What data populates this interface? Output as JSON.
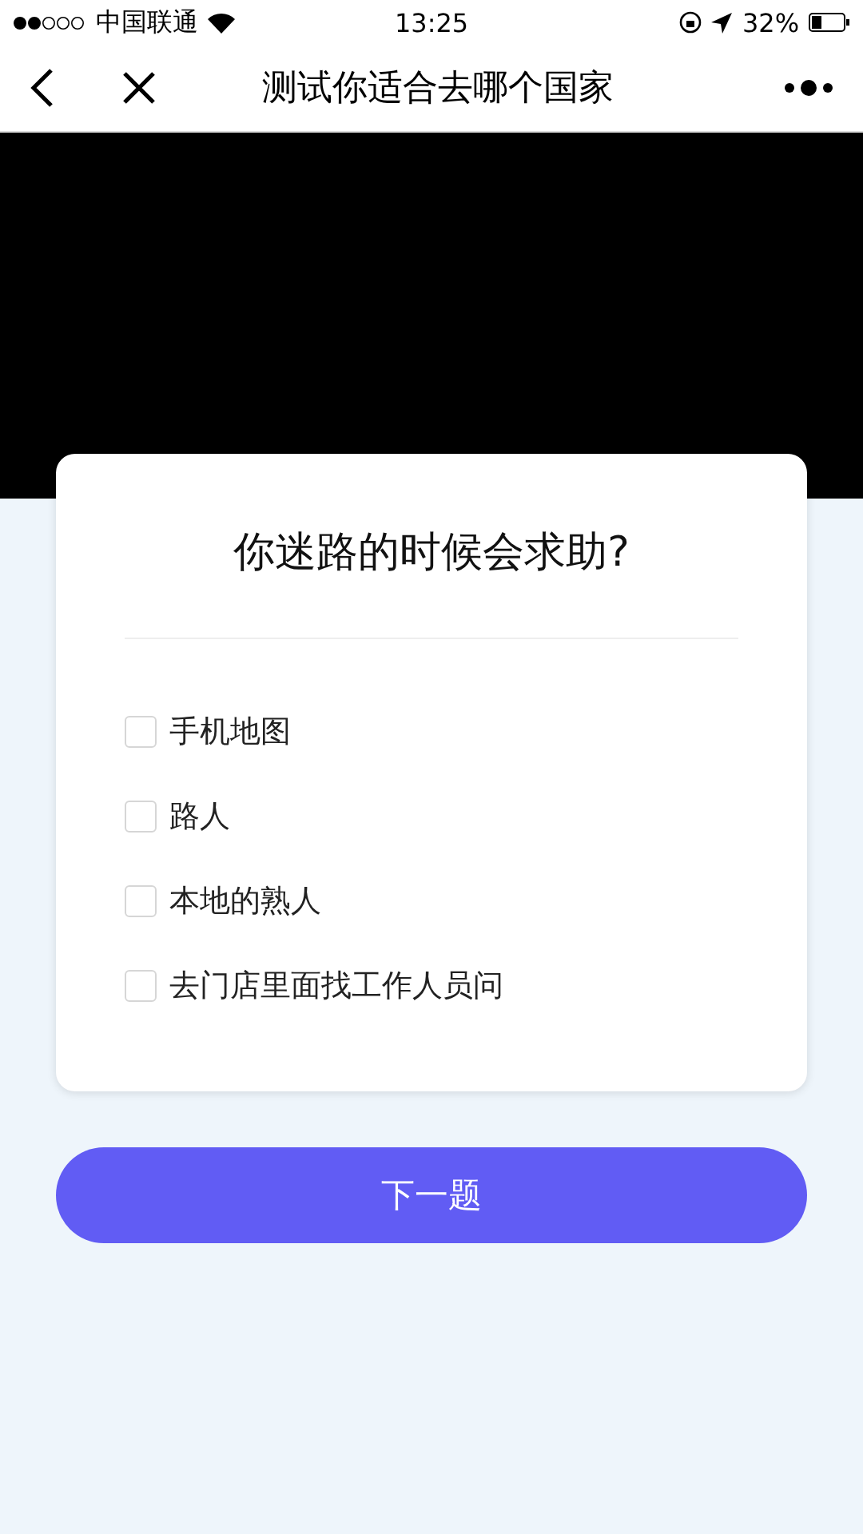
{
  "status_bar": {
    "carrier": "中国联通",
    "time": "13:25",
    "battery_text": "32%"
  },
  "nav_bar": {
    "title": "测试你适合去哪个国家"
  },
  "question": {
    "text": "你迷路的时候会求助?"
  },
  "options": [
    {
      "label": "手机地图",
      "checked": false
    },
    {
      "label": "路人",
      "checked": false
    },
    {
      "label": "本地的熟人",
      "checked": false
    },
    {
      "label": "去门店里面找工作人员问",
      "checked": false
    }
  ],
  "next_button": {
    "label": "下一题"
  }
}
